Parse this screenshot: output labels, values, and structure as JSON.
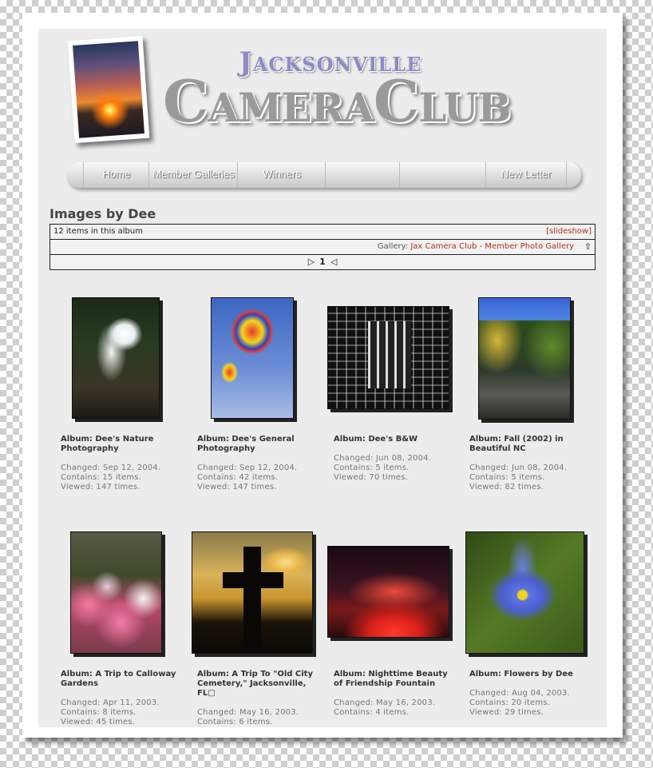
{
  "site": {
    "logo_line1": "Jacksonville",
    "logo_line2": "CameraClub"
  },
  "nav": {
    "items": [
      "Home",
      "Member Galleries",
      "Winners",
      "",
      "",
      "New Letter"
    ]
  },
  "album": {
    "title": "Images by Dee",
    "item_count_text": "12 items in this album",
    "slideshow_link": "[slideshow]",
    "gallery_prefix": "Gallery: ",
    "gallery_link": "Jax Camera Club - Member Photo Gallery",
    "page_number": "1"
  },
  "cards": [
    {
      "title": "Album: Dee's Nature Photography",
      "changed": "Changed: Sep 12, 2004.",
      "contains": "Contains: 15 items.",
      "viewed": "Viewed: 147 times."
    },
    {
      "title": "Album: Dee's General Photography",
      "changed": "Changed: Sep 12, 2004.",
      "contains": "Contains: 42 items.",
      "viewed": "Viewed: 147 times."
    },
    {
      "title": "Album: Dee's B&W",
      "changed": "Changed: Jun 08, 2004.",
      "contains": "Contains: 5 items.",
      "viewed": "Viewed: 70 times."
    },
    {
      "title": "Album: Fall (2002) in Beautiful NC",
      "changed": "Changed: Jun 08, 2004.",
      "contains": "Contains: 5 items.",
      "viewed": "Viewed: 82 times."
    },
    {
      "title": "Album: A Trip to Calloway Gardens",
      "changed": "Changed: Apr 11, 2003.",
      "contains": "Contains: 8 items.",
      "viewed": "Viewed: 45 times."
    },
    {
      "title": "Album: A Trip To \"Old City Cemetery,\" Jacksonville, FL□",
      "changed": "Changed: May 16, 2003.",
      "contains": "Contains: 6 items.",
      "viewed": ""
    },
    {
      "title": "Album: Nighttime Beauty of Friendship Fountain",
      "changed": "Changed: May 16, 2003.",
      "contains": "Contains: 4 items.",
      "viewed": ""
    },
    {
      "title": "Album: Flowers by Dee",
      "changed": "Changed: Aug 04, 2003.",
      "contains": "Contains: 20 items.",
      "viewed": "Viewed: 29 times."
    }
  ]
}
